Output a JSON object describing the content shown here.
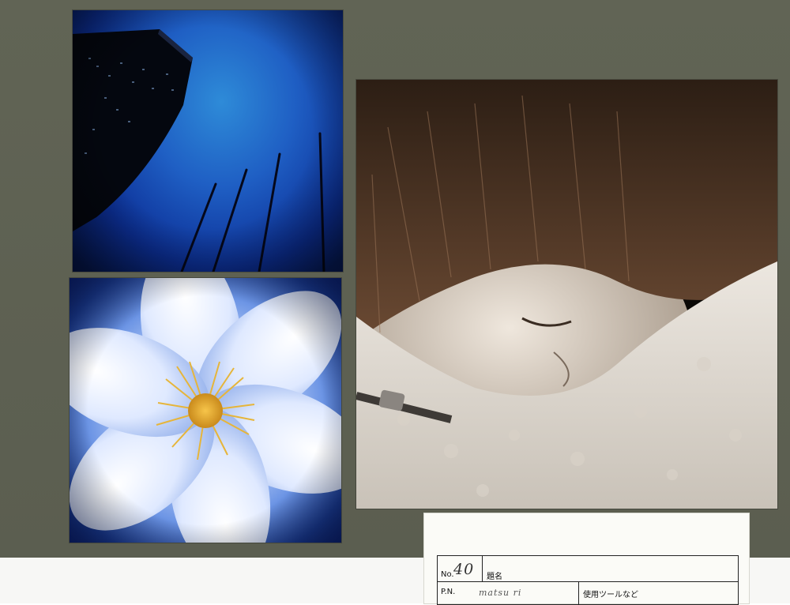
{
  "label": {
    "no_label": "No.",
    "no_value": "40",
    "title_label": "題名",
    "pn_label": "P.N.",
    "pn_value": "matsu ri",
    "tools_label": "使用ツールなど"
  },
  "photos": [
    {
      "subject": "skyscraper and flagpoles against blue sky"
    },
    {
      "subject": "white clematis flower with yellow stamens"
    },
    {
      "subject": "child sleeping in fleece blanket, monochrome"
    }
  ]
}
